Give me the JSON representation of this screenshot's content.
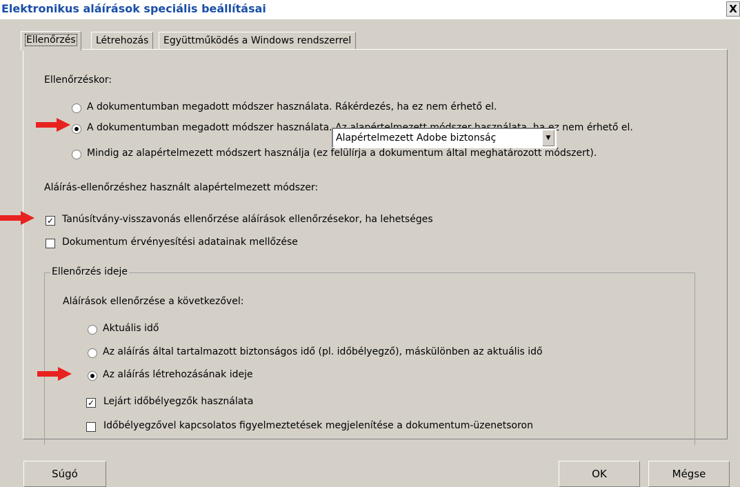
{
  "window": {
    "title": "Elektronikus aláírások speciális beállításai",
    "close_label": "X"
  },
  "tabs": [
    {
      "label": "Ellenőrzés",
      "active": true
    },
    {
      "label": "Létrehozás",
      "active": false
    },
    {
      "label": "Együttműködés a Windows rendszerrel",
      "active": false
    }
  ],
  "verify": {
    "heading": "Ellenőrzéskor:",
    "options": [
      {
        "label": "A dokumentumban megadott módszer használata. Rákérdezés, ha ez nem érhető el.",
        "checked": false
      },
      {
        "label": "A dokumentumban megadott módszer használata. Az alapértelmezett módszer használata, ha ez nem érhető el.",
        "checked": true
      },
      {
        "label": "Mindig az alapértelmezett módszert használja (ez felülírja a dokumentum által meghatározott módszert).",
        "checked": false
      }
    ],
    "default_method_label": "Aláírás-ellenőrzéshez használt alapértelmezett módszer:",
    "default_method_value": "Alapértelmezett Adobe biztonsáç",
    "checkboxes": [
      {
        "label": "Tanúsítvány-visszavonás ellenőrzése aláírások ellenőrzésekor, ha lehetséges",
        "checked": true
      },
      {
        "label": "Dokumentum érvényesítési adatainak mellőzése",
        "checked": false
      }
    ]
  },
  "time": {
    "legend": "Ellenőrzés ideje",
    "subheading": "Aláírások ellenőrzése a következővel:",
    "options": [
      {
        "label": "Aktuális idő",
        "checked": false
      },
      {
        "label": "Az aláírás által tartalmazott biztonságos idő (pl. időbélyegző), máskülönben az aktuális idő",
        "checked": false
      },
      {
        "label": "Az aláírás létrehozásának ideje",
        "checked": true
      }
    ],
    "checkboxes": [
      {
        "label": "Lejárt időbélyegzők használata",
        "checked": true
      },
      {
        "label": "Időbélyegzővel kapcsolatos figyelmeztetések megjelenítése a dokumentum-üzenetsoron",
        "checked": false
      }
    ]
  },
  "buttons": {
    "help": "Súgó",
    "ok": "OK",
    "cancel": "Mégse"
  },
  "colors": {
    "annotation_arrow": "#e8221f",
    "title_text": "#1a4fa8"
  }
}
